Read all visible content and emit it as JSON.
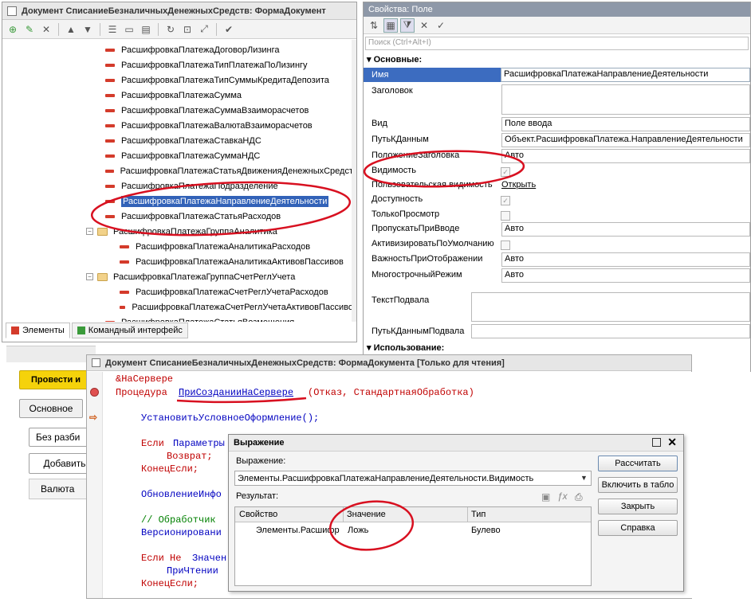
{
  "form_editor": {
    "title": "Документ СписаниеБезналичныхДенежныхСредств: ФормаДокумент",
    "tree": [
      {
        "label": "РасшифровкаПлатежаДоговорЛизинга",
        "kind": "field",
        "level": 1
      },
      {
        "label": "РасшифровкаПлатежаТипПлатежаПоЛизингу",
        "kind": "field",
        "level": 1
      },
      {
        "label": "РасшифровкаПлатежаТипСуммыКредитаДепозита",
        "kind": "field",
        "level": 1
      },
      {
        "label": "РасшифровкаПлатежаСумма",
        "kind": "field",
        "level": 1
      },
      {
        "label": "РасшифровкаПлатежаСуммаВзаиморасчетов",
        "kind": "field",
        "level": 1
      },
      {
        "label": "РасшифровкаПлатежаВалютаВзаиморасчетов",
        "kind": "field",
        "level": 1
      },
      {
        "label": "РасшифровкаПлатежаСтавкаНДС",
        "kind": "field",
        "level": 1
      },
      {
        "label": "РасшифровкаПлатежаСуммаНДС",
        "kind": "field",
        "level": 1
      },
      {
        "label": "РасшифровкаПлатежаСтатьяДвиженияДенежныхСредст",
        "kind": "field",
        "level": 1
      },
      {
        "label": "РасшифровкаПлатежаПодразделение",
        "kind": "field",
        "level": 1
      },
      {
        "label": "РасшифровкаПлатежаНаправлениеДеятельности",
        "kind": "field",
        "level": 1,
        "selected": true
      },
      {
        "label": "РасшифровкаПлатежаСтатьяРасходов",
        "kind": "field",
        "level": 1
      },
      {
        "label": "РасшифровкаПлатежаГруппаАналитика",
        "kind": "group",
        "level": 1
      },
      {
        "label": "РасшифровкаПлатежаАналитикаРасходов",
        "kind": "field",
        "level": 2
      },
      {
        "label": "РасшифровкаПлатежаАналитикаАктивовПассивов",
        "kind": "field",
        "level": 2
      },
      {
        "label": "РасшифровкаПлатежаГруппаСчетРеглУчета",
        "kind": "group",
        "level": 1
      },
      {
        "label": "РасшифровкаПлатежаСчетРеглУчетаРасходов",
        "kind": "field",
        "level": 2
      },
      {
        "label": "РасшифровкаПлатежаСчетРеглУчетаАктивовПассиво",
        "kind": "field",
        "level": 2
      },
      {
        "label": "РасшифровкаПлатежаСтатьяВозмещения",
        "kind": "field",
        "level": 1
      }
    ],
    "tabs": [
      "Элементы",
      "Командный интерфейс"
    ]
  },
  "properties": {
    "title": "Свойства: Поле",
    "search_placeholder": "Поиск (Ctrl+Alt+I)",
    "section_main": "Основные:",
    "section_usage": "Использование:",
    "rows": {
      "name": {
        "label": "Имя",
        "value": "РасшифровкаПлатежаНаправлениеДеятельности"
      },
      "header": {
        "label": "Заголовок"
      },
      "kind": {
        "label": "Вид",
        "value": "Поле ввода"
      },
      "datapath": {
        "label": "ПутьКДанным",
        "value": "Объект.РасшифровкаПлатежа.НаправлениеДеятельности"
      },
      "header_pos": {
        "label": "ПоложениеЗаголовка",
        "value": "Авто"
      },
      "visible": {
        "label": "Видимость",
        "checked": true
      },
      "user_vis": {
        "label": "Пользовательская видимость",
        "link": "Открыть"
      },
      "enabled": {
        "label": "Доступность",
        "checked": true
      },
      "readonly": {
        "label": "ТолькоПросмотр",
        "checked": false
      },
      "skip_input": {
        "label": "ПропускатьПриВводе",
        "value": "Авто"
      },
      "activate_default": {
        "label": "АктивизироватьПоУмолчанию",
        "checked": false
      },
      "importance": {
        "label": "ВажностьПриОтображении",
        "value": "Авто"
      },
      "multiline": {
        "label": "МногострочныйРежим",
        "value": "Авто"
      },
      "footer_text": {
        "label": "ТекстПодвала"
      },
      "footer_path": {
        "label": "ПутьКДаннымПодвала"
      }
    }
  },
  "bg_form": {
    "post_button": "Провести и",
    "tab_main": "Основное",
    "no_split": "Без разби",
    "add": "Добавить",
    "currency_col": "Валюта"
  },
  "code_window": {
    "title": "Документ СписаниеБезналичныхДенежныхСредств: ФормаДокумента [Только для чтения]",
    "lines": {
      "l1": "&НаСервере",
      "l2_kw": "Процедура ",
      "l2_name": "ПриСозданииНаСервере",
      "l2_params": "(Отказ, СтандартнаяОбработка)",
      "l3": "УстановитьУсловноеОформление();",
      "l4_kw": "Если ",
      "l4_rest": "Параметры",
      "l5": "Возврат;",
      "l6": "КонецЕсли;",
      "l7": "ОбновлениеИнфо",
      "l8": "// Обработчик",
      "l9": "Версионировани",
      "l10_kw": "Если Не ",
      "l10_rest": "Значен",
      "l11": "ПриЧтении",
      "l12": "КонецЕсли;"
    }
  },
  "expression_dialog": {
    "title": "Выражение",
    "expr_label": "Выражение:",
    "expr_value": "Элементы.РасшифровкаПлатежаНаправлениеДеятельности.Видимость",
    "result_label": "Результат:",
    "columns": [
      "Свойство",
      "Значение",
      "Тип"
    ],
    "rows": [
      {
        "property": "Элементы.Расшифр",
        "value": "Ложь",
        "type": "Булево"
      }
    ],
    "buttons": {
      "calc": "Рассчитать",
      "include": "Включить в табло",
      "close": "Закрыть",
      "help": "Справка"
    }
  }
}
